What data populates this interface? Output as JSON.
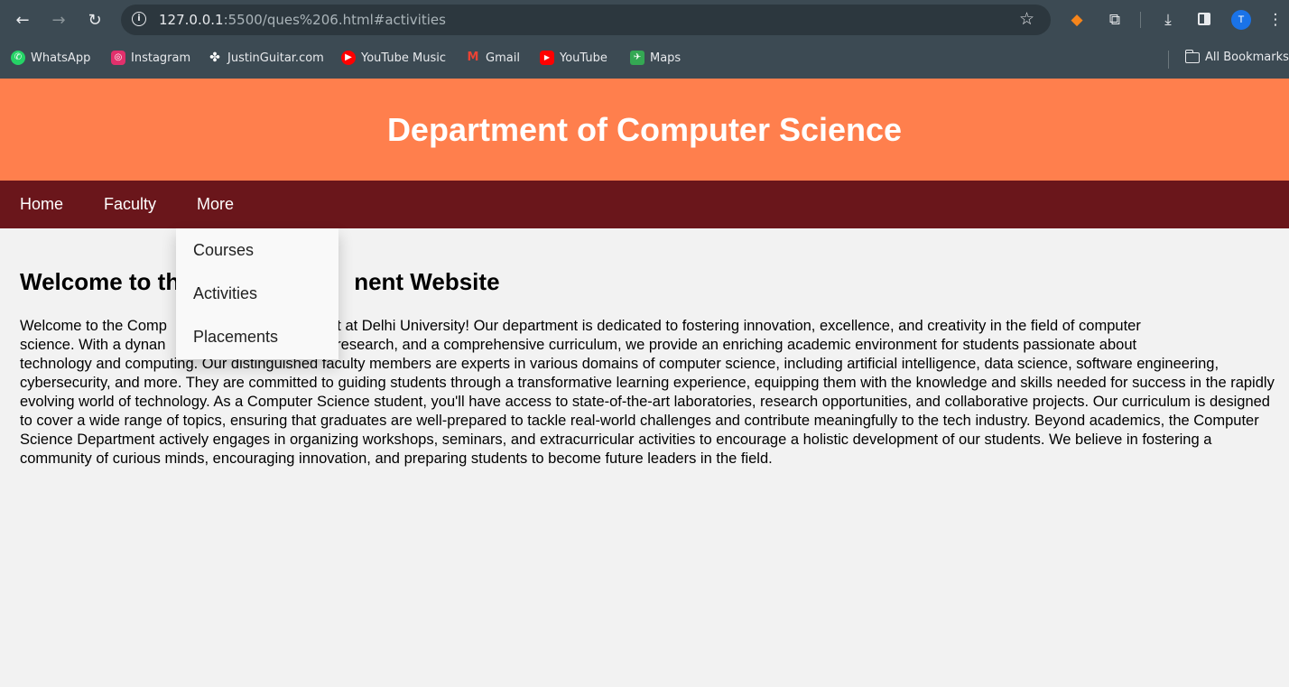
{
  "browser": {
    "url_host": "127.0.0.1",
    "url_rest": ":5500/ques%206.html#activities",
    "avatar_letter": "T",
    "bookmarks": [
      {
        "label": "WhatsApp",
        "icon": "whatsapp-icon",
        "color": "#25d366"
      },
      {
        "label": "Instagram",
        "icon": "instagram-icon",
        "color": "#e1306c"
      },
      {
        "label": "JustinGuitar.com",
        "icon": "justinguitar-icon",
        "color": "#ffffff"
      },
      {
        "label": "YouTube Music",
        "icon": "youtube-music-icon",
        "color": "#ff0000"
      },
      {
        "label": "Gmail",
        "icon": "gmail-icon",
        "color": "#ea4335"
      },
      {
        "label": "YouTube",
        "icon": "youtube-icon",
        "color": "#ff0000"
      },
      {
        "label": "Maps",
        "icon": "maps-icon",
        "color": "#34a853"
      }
    ],
    "all_bookmarks_label": "All Bookmarks"
  },
  "header": {
    "title": "Department of Computer Science",
    "bg_color": "#ff7f4d"
  },
  "nav": {
    "bg_color": "#6a161b",
    "items": [
      "Home",
      "Faculty",
      "More"
    ],
    "dropdown": [
      "Courses",
      "Activities",
      "Placements"
    ]
  },
  "main": {
    "heading_left": "Welcome to th",
    "heading_right": "nent Website",
    "para_line1_start": "Welcome to the Comp",
    "para_line1_end": "ent at Delhi University! Our department is dedicated to fostering innovation, excellence, and creativity in the field of computer",
    "para_line2_start": "science. With a dynan",
    "para_line2_end": "e research, and a comprehensive curriculum, we provide an enriching academic environment for students passionate about",
    "para_rest": "technology and computing. Our distinguished faculty members are experts in various domains of computer science, including artificial intelligence, data science, software engineering, cybersecurity, and more. They are committed to guiding students through a transformative learning experience, equipping them with the knowledge and skills needed for success in the rapidly evolving world of technology. As a Computer Science student, you'll have access to state-of-the-art laboratories, research opportunities, and collaborative projects. Our curriculum is designed to cover a wide range of topics, ensuring that graduates are well-prepared to tackle real-world challenges and contribute meaningfully to the tech industry. Beyond academics, the Computer Science Department actively engages in organizing workshops, seminars, and extracurricular activities to encourage a holistic development of our students. We believe in fostering a community of curious minds, encouraging innovation, and preparing students to become future leaders in the field."
  }
}
